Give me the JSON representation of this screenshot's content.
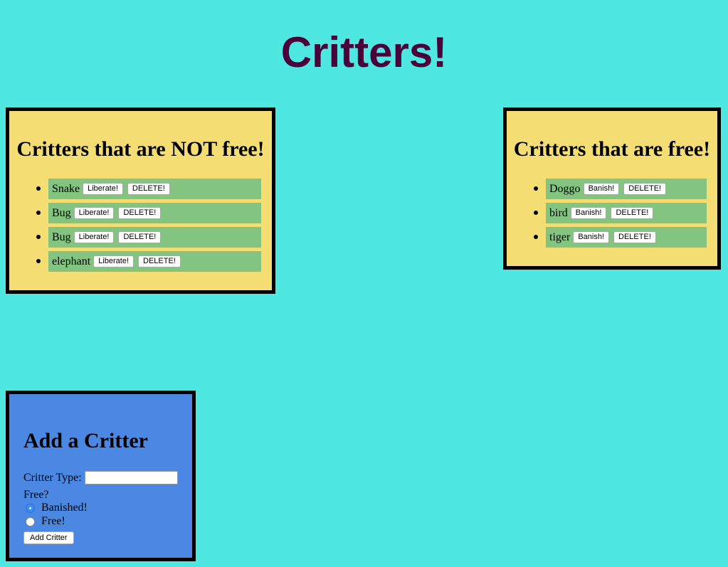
{
  "page": {
    "title": "Critters!"
  },
  "not_free": {
    "heading": "Critters that are NOT free!",
    "items": [
      {
        "name": "Snake",
        "action_label": "Liberate!",
        "delete_label": "DELETE!"
      },
      {
        "name": "Bug",
        "action_label": "Liberate!",
        "delete_label": "DELETE!"
      },
      {
        "name": "Bug",
        "action_label": "Liberate!",
        "delete_label": "DELETE!"
      },
      {
        "name": "elephant",
        "action_label": "Liberate!",
        "delete_label": "DELETE!"
      }
    ]
  },
  "free": {
    "heading": "Critters that are free!",
    "items": [
      {
        "name": "Doggo",
        "action_label": "Banish!",
        "delete_label": "DELETE!"
      },
      {
        "name": "bird",
        "action_label": "Banish!",
        "delete_label": "DELETE!"
      },
      {
        "name": "tiger",
        "action_label": "Banish!",
        "delete_label": "DELETE!"
      }
    ]
  },
  "add_form": {
    "heading": "Add a Critter",
    "type_label": "Critter Type:",
    "type_value": "",
    "free_label": "Free?",
    "option_banished": "Banished!",
    "option_free": "Free!",
    "selected_option": "Banished!",
    "submit_label": "Add Critter"
  },
  "colors": {
    "background": "#4ee8e0",
    "title": "#4a0039",
    "list_panel": "#f4de73",
    "list_item": "#82c480",
    "form_panel": "#4a88e4"
  }
}
